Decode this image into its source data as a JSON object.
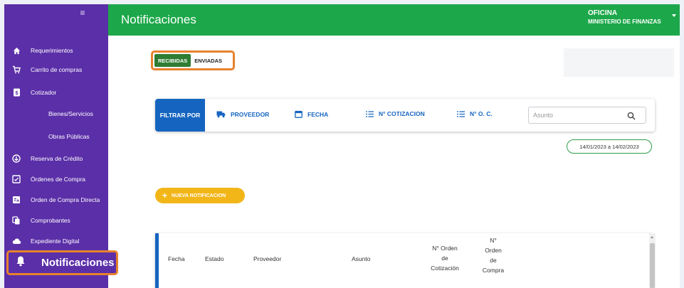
{
  "sidebar": {
    "items": [
      {
        "label": "Requerimientos",
        "icon": "home-icon"
      },
      {
        "label": "Carrito de compras",
        "icon": "cart-icon"
      },
      {
        "label": "Cotizador",
        "icon": "document-dollar-icon"
      },
      {
        "label": "Bienes/Servicios"
      },
      {
        "label": "Obras Públicas"
      },
      {
        "label": "Reserva de Crédito",
        "icon": "credit-reserve-icon"
      },
      {
        "label": "Órdenes de Compra",
        "icon": "purchase-order-icon"
      },
      {
        "label": "Orden de Compra Directa",
        "icon": "direct-order-icon"
      },
      {
        "label": "Comprobantes",
        "icon": "receipts-icon"
      },
      {
        "label": "Expediente Digital",
        "icon": "cloud-icon"
      }
    ],
    "active": {
      "label": "Notificaciones",
      "icon": "bell-icon"
    }
  },
  "header": {
    "title": "Notificaciones",
    "office_title": "OFICINA",
    "office_name": "MINISTERIO DE FINANZAS"
  },
  "tabs": {
    "received": "RECIBIDAS",
    "sent": "ENVIADAS"
  },
  "filter": {
    "label": "FILTRAR POR",
    "options": [
      "PROVEEDOR",
      "FECHA",
      "N° COTIZACION",
      "N° O. C."
    ],
    "search_placeholder": "Asunto"
  },
  "date_range": "14/01/2023 a 14/02/2023",
  "new_button": "NUEVA NOTIFICACION",
  "table": {
    "columns": {
      "fecha": "Fecha",
      "estado": "Estado",
      "proveedor": "Proveedor",
      "asunto": "Asunto",
      "cotizacion_lines": [
        "N° Orden",
        "de",
        "Cotización"
      ],
      "compra_lines": [
        "N°",
        "Orden",
        "de",
        "Compra"
      ]
    }
  },
  "colors": {
    "sidebar": "#5b2fa8",
    "header": "#1ca84a",
    "highlight": "#e6822d",
    "primary_blue": "#1565c0",
    "tab_active": "#2e7d32",
    "button_yellow": "#f2b619"
  }
}
